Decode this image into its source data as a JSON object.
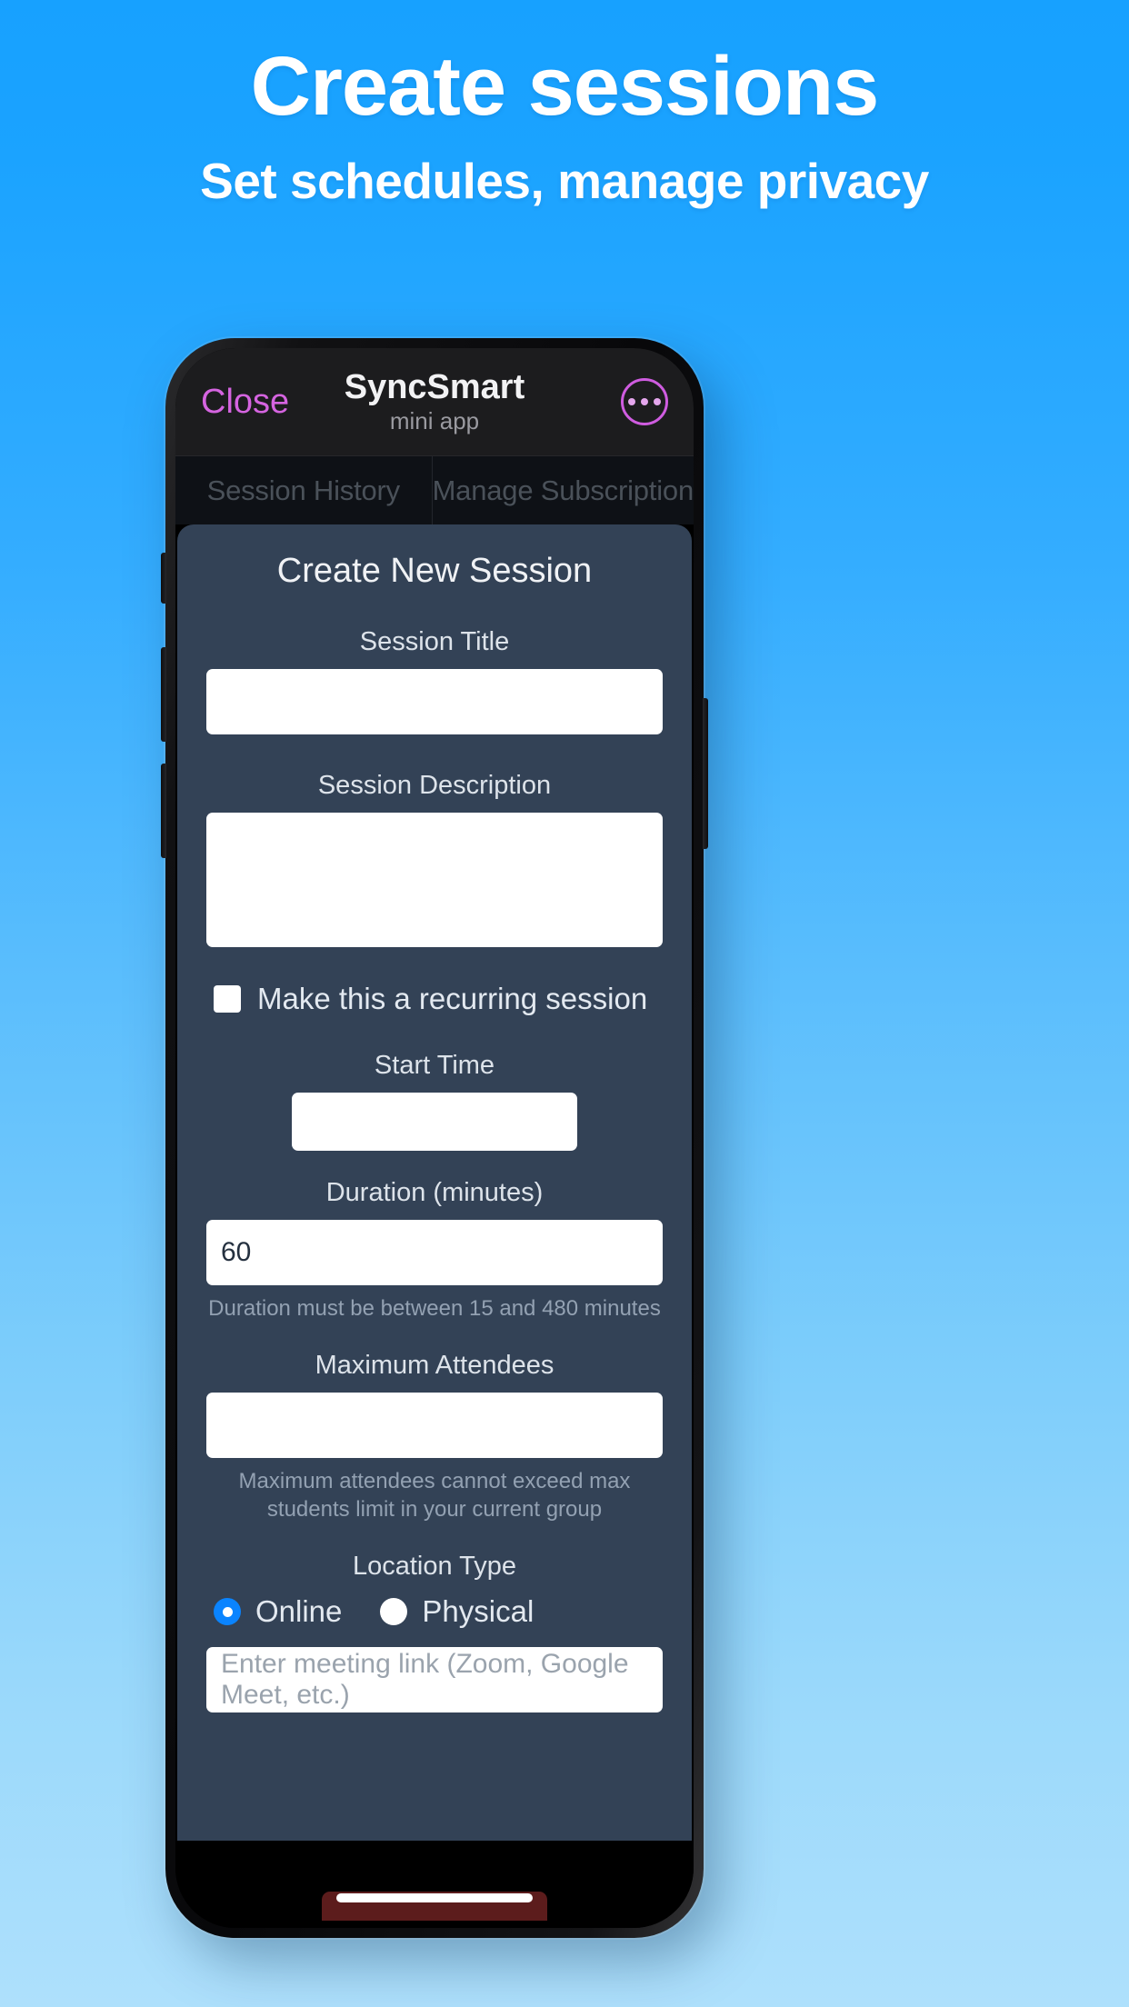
{
  "marketing": {
    "headline": "Create sessions",
    "subheadline": "Set schedules, manage privacy"
  },
  "colors": {
    "background_top": "#17a1ff",
    "background_bottom": "#aee0fc",
    "accent_close": "#d564e0",
    "accent_menu": "#cf5ce0",
    "radio_selected": "#0a84ff",
    "card_background": "#334256"
  },
  "app": {
    "header": {
      "close_label": "Close",
      "title": "SyncSmart",
      "subtitle": "mini app",
      "menu_icon": "ellipsis-circle-icon"
    },
    "tabs": [
      {
        "label": "Session History"
      },
      {
        "label": "Manage Subscription"
      }
    ],
    "form": {
      "title": "Create New Session",
      "fields": {
        "session_title": {
          "label": "Session Title",
          "value": "",
          "placeholder": ""
        },
        "session_description": {
          "label": "Session Description",
          "value": "",
          "placeholder": ""
        },
        "recurring": {
          "label": "Make this a recurring session",
          "checked": false
        },
        "start_time": {
          "label": "Start Time",
          "value": "",
          "placeholder": ""
        },
        "duration": {
          "label": "Duration (minutes)",
          "value": "60",
          "helper": "Duration must be between 15 and 480 minutes"
        },
        "max_attendees": {
          "label": "Maximum Attendees",
          "value": "",
          "placeholder": "",
          "helper": "Maximum attendees cannot exceed max students limit in your current group"
        },
        "location_type": {
          "label": "Location Type",
          "options": [
            {
              "label": "Online",
              "selected": true
            },
            {
              "label": "Physical",
              "selected": false
            }
          ]
        },
        "meeting_link": {
          "value": "",
          "placeholder": "Enter meeting link (Zoom, Google Meet, etc.)"
        }
      }
    }
  }
}
